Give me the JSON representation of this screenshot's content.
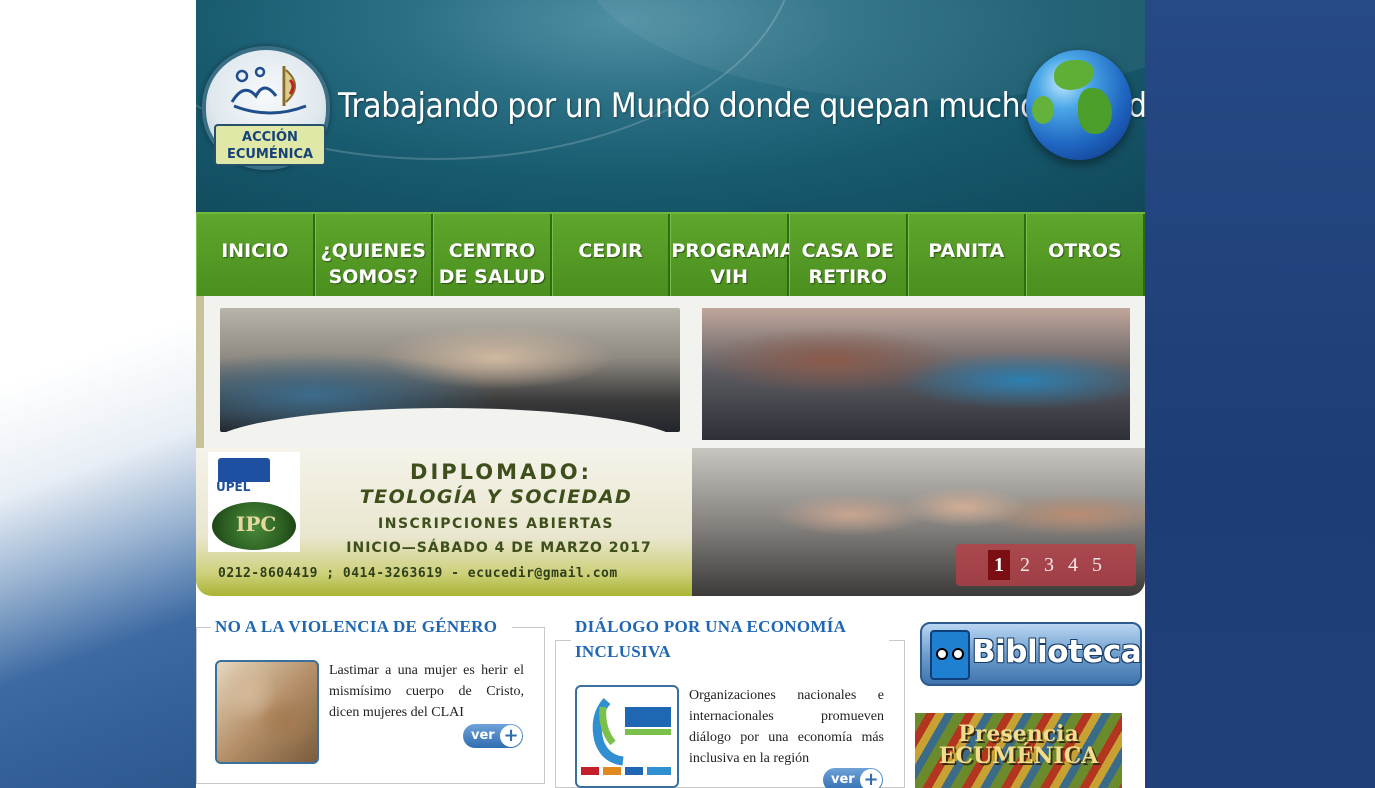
{
  "header": {
    "logo_text_line1": "ACCIÓN",
    "logo_text_line2": "ECUMÉNICA",
    "tagline": "Trabajando por un Mundo donde quepan muchos mundos"
  },
  "nav": {
    "items": [
      {
        "line1": "INICIO",
        "line2": ""
      },
      {
        "line1": "¿QUIENES",
        "line2": "SOMOS?"
      },
      {
        "line1": "CENTRO",
        "line2": "DE SALUD"
      },
      {
        "line1": "CEDIR",
        "line2": ""
      },
      {
        "line1": "PROGRAMA",
        "line2": "VIH"
      },
      {
        "line1": "CASA DE",
        "line2": "RETIRO"
      },
      {
        "line1": "PANITA",
        "line2": ""
      },
      {
        "line1": "OTROS",
        "line2": ""
      }
    ]
  },
  "slider": {
    "upel": "UPEL",
    "ipc": "IPC",
    "title": "DIPLOMADO:",
    "subtitle": "TEOLOGÍA Y SOCIEDAD",
    "line3": "INSCRIPCIONES ABIERTAS",
    "line4": "INICIO—SÁBADO 4 DE MARZO 2017",
    "contact": "0212-8604419 ; 0414-3263619 -  ecucedir@gmail.com",
    "pager": [
      "1",
      "2",
      "3",
      "4",
      "5"
    ],
    "active_page": "1"
  },
  "content": {
    "box1": {
      "title": "NO A LA VIOLENCIA DE GÉNERO",
      "text": "Lastimar a una mujer es herir el mismísimo cuerpo de Cristo, dicen mujeres del CLAI",
      "button": "ver"
    },
    "box2": {
      "title_line1": "DIÁLOGO POR UNA ECONOMÍA",
      "title_line2": "INCLUSIVA",
      "text": "Organizaciones nacionales e internacionales promueven diálogo por una economía más inclusiva en la región",
      "button": "ver"
    },
    "biblioteca": "Biblioteca",
    "presencia_line1": "Presencia",
    "presencia_line2": "ECUMÉNICA"
  },
  "colors": {
    "nav_green": "#4f9222",
    "header_teal": "#175a6e",
    "title_blue": "#1f66b3",
    "pager_active": "#7a0e12"
  }
}
